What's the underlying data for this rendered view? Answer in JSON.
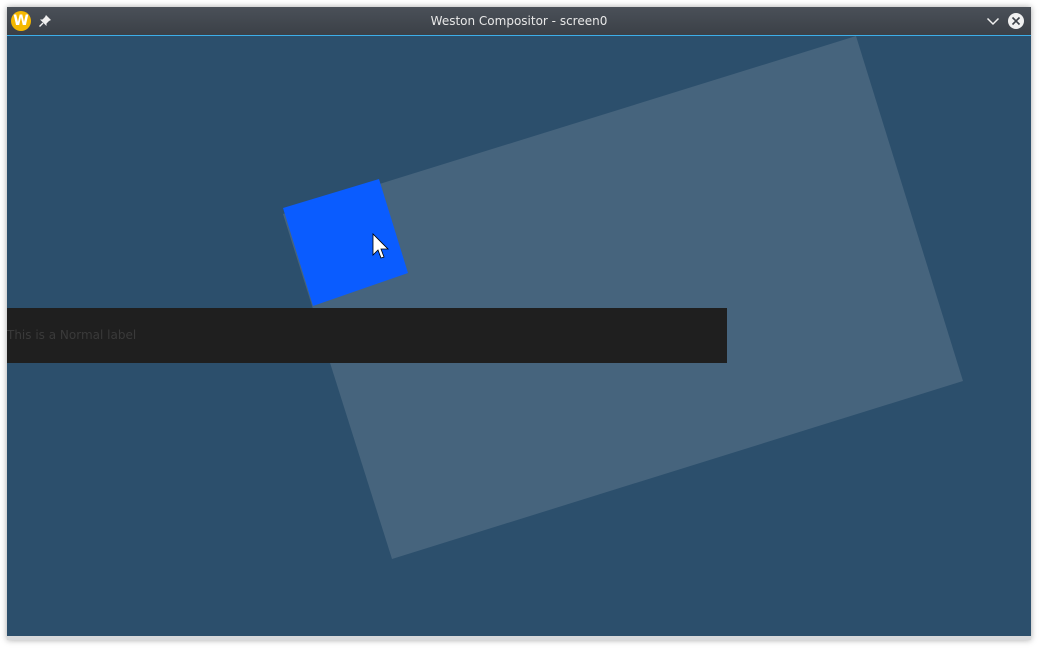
{
  "window": {
    "title": "Weston Compositor - screen0",
    "app_icon": "weston-icon",
    "app_icon_letter": "W",
    "buttons": {
      "pin_icon": "pin-icon",
      "minimize_icon": "chevron-down-icon",
      "close_icon": "close-icon"
    }
  },
  "scene": {
    "large_rectangle_color": "#46647d",
    "small_square_color": "#0a5cff",
    "background_color": "#2c4f6c",
    "cursor_icon": "mouse-pointer-icon"
  },
  "label": {
    "text": "This is a Normal label",
    "background_color": "#1f1f1f"
  }
}
